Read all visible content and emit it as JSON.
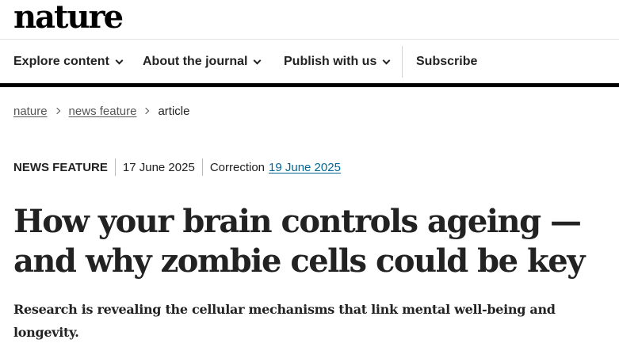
{
  "site": {
    "logo": "nature"
  },
  "nav": {
    "explore": "Explore content",
    "about": "About the journal",
    "publish": "Publish with us",
    "subscribe": "Subscribe"
  },
  "breadcrumb": [
    "nature",
    "news feature",
    "article"
  ],
  "article": {
    "type": "NEWS FEATURE",
    "date": "17 June 2025",
    "correction_label": "Correction",
    "correction_date": "19 June 2025",
    "title_line1": "How your brain controls ageing —",
    "title_line2": "and why zombie cells could be key",
    "standfirst": "Research is revealing the cellular mechanisms that link mental well-being and longevity."
  },
  "colors": {
    "link": "#006699",
    "text": "#222222",
    "rule": "#000000"
  },
  "icons": {
    "nav_dropdown": "chevron-down-icon",
    "breadcrumb_separator": "chevron-right-icon"
  }
}
